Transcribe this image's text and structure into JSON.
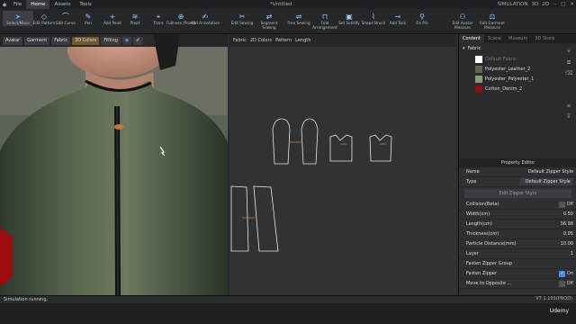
{
  "menubar": {
    "items": [
      "File",
      "Home",
      "Assets",
      "Tools"
    ],
    "active": "Home",
    "title": "*Untitled",
    "workspaces": [
      "SIMULATION",
      "3D",
      "2D"
    ]
  },
  "toolbar": {
    "tools": [
      {
        "label": "Select/Move",
        "icon": "arrow-select-icon"
      },
      {
        "label": "Edit Pattern",
        "icon": "edit-pattern-icon"
      },
      {
        "label": "Edit Curve",
        "icon": "edit-curve-icon"
      },
      {
        "label": "Pen",
        "icon": "pen-icon"
      },
      {
        "label": "Add Point",
        "icon": "add-point-icon"
      },
      {
        "label": "Pleat",
        "icon": "pleat-icon"
      },
      {
        "label": "Trace",
        "icon": "trace-icon"
      },
      {
        "label": "Fullness (Point)",
        "icon": "fullness-icon"
      },
      {
        "label": "Add Annotation",
        "icon": "annotation-icon"
      },
      {
        "label": "Edit Sewing",
        "icon": "edit-sewing-icon"
      },
      {
        "label": "Segment Sewing",
        "icon": "segment-sewing-icon"
      },
      {
        "label": "Free Sewing",
        "icon": "free-sewing-icon"
      },
      {
        "label": "Fold Arrangement",
        "icon": "fold-icon"
      },
      {
        "label": "Set Solidify",
        "icon": "solidify-icon"
      },
      {
        "label": "Shape Brush",
        "icon": "brush-icon"
      },
      {
        "label": "Add Tack",
        "icon": "tack-icon"
      },
      {
        "label": "Fix Pin",
        "icon": "pin-icon"
      },
      {
        "label": "Edit Avatar Measure",
        "icon": "avatar-measure-icon"
      },
      {
        "label": "Edit Garment Measure",
        "icon": "garment-measure-icon"
      }
    ]
  },
  "left_view": {
    "tabs": [
      "Avatar",
      "Garment",
      "Fabric",
      "3D Colors",
      "Fitting"
    ]
  },
  "right_view": {
    "tabs": [
      "Fabric",
      "2D Colors",
      "Pattern",
      "Length"
    ]
  },
  "right_panel": {
    "tabs": [
      "Content",
      "Scene",
      "Museum",
      "3D Store"
    ],
    "fabric_title": "Fabric",
    "fabrics": [
      {
        "name": "Default Fabric",
        "color": "#ffffff",
        "dim": true
      },
      {
        "name": "Polyester_Leather_2",
        "color": "#5d6650",
        "dim": false
      },
      {
        "name": "Polyester_Polyester_1",
        "color": "#8a9a78",
        "dim": false
      },
      {
        "name": "Cotton_Denim_2",
        "color": "#8a1010",
        "dim": false
      }
    ]
  },
  "property_editor": {
    "title": "Property Editor",
    "name_label": "Name",
    "name_value": "Default Zipper Style",
    "type_label": "Type",
    "type_value": "Default Zipper Style",
    "edit_button": "Edit Zipper Style",
    "collision_label": "Collision(Beta)",
    "collision_state": "Off",
    "rows": [
      {
        "label": "Width(cm)",
        "value": "0.50"
      },
      {
        "label": "Length(cm)",
        "value": "36.98"
      },
      {
        "label": "Thickness(cm)",
        "value": "0.05"
      },
      {
        "label": "Particle Distance(mm)",
        "value": "10.00"
      },
      {
        "label": "Layer",
        "value": "1"
      }
    ],
    "group_label": "Fasten Zipper Group",
    "fasten_label": "Fasten Zipper",
    "fasten_state": "On",
    "move_label": "Move to Opposite ...",
    "move_state": "Off"
  },
  "status": {
    "message": "Simulation running.",
    "version": "V7.1.103(PROD)"
  },
  "watermark": "Udemy"
}
